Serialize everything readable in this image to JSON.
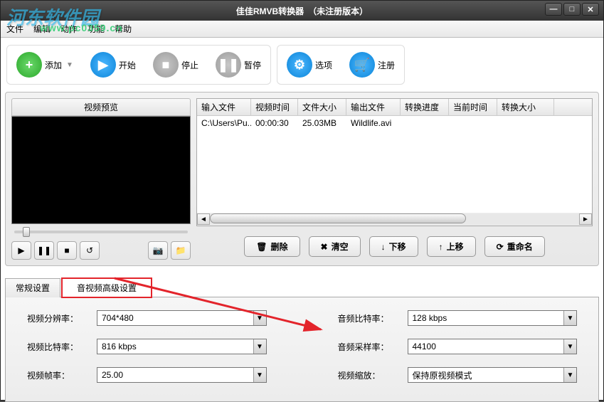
{
  "title": "佳佳RMVB转换器　（未注册版本）",
  "watermark_text": "河东软件园",
  "watermark_url": "www.pc0359.cn",
  "menu": {
    "file": "文件",
    "edit": "编辑",
    "action": "动作",
    "function": "功能",
    "help": "帮助"
  },
  "toolbar": {
    "add": "添加",
    "start": "开始",
    "stop": "停止",
    "pause": "暂停",
    "options": "选项",
    "register": "注册"
  },
  "preview": {
    "title": "视频预览"
  },
  "file_table": {
    "headers": [
      "输入文件",
      "视频时间",
      "文件大小",
      "输出文件",
      "转换进度",
      "当前时间",
      "转换大小"
    ],
    "rows": [
      {
        "input": "C:\\Users\\Pu...",
        "duration": "00:00:30",
        "size": "25.03MB",
        "output": "Wildlife.avi",
        "progress": "",
        "current": "",
        "convsize": ""
      }
    ]
  },
  "actions": {
    "delete": "删除",
    "clear": "清空",
    "movedown": "下移",
    "moveup": "上移",
    "rename": "重命名"
  },
  "tabs": {
    "general": "常规设置",
    "advanced": "音视频高级设置"
  },
  "settings": {
    "resolution_label": "视频分辨率：",
    "resolution_value": "704*480",
    "vbitrate_label": "视频比特率：",
    "vbitrate_value": "816 kbps",
    "fps_label": "视频帧率：",
    "fps_value": "25.00",
    "abitrate_label": "音频比特率：",
    "abitrate_value": "128 kbps",
    "asample_label": "音频采样率：",
    "asample_value": "44100",
    "scale_label": "视频缩放：",
    "scale_value": "保持原视频模式"
  }
}
